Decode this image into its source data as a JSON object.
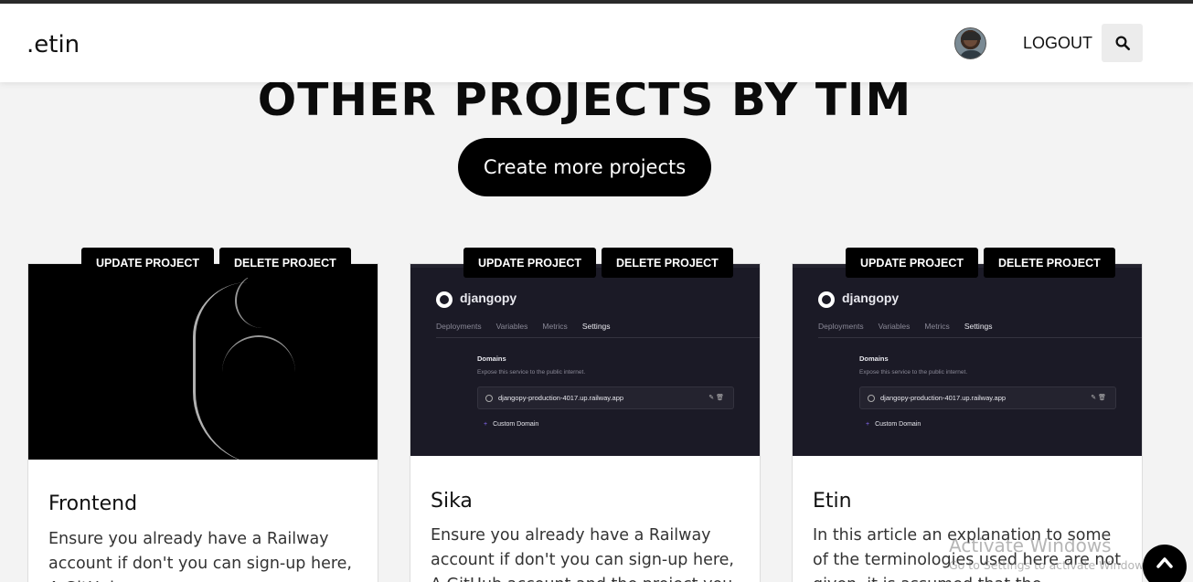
{
  "header": {
    "logo": ".etin",
    "logout_label": "LOGOUT",
    "search_icon": "search-icon",
    "avatar": "user-avatar"
  },
  "main": {
    "title": "OTHER PROJECTS BY TIM",
    "create_button": "Create more projects"
  },
  "projects": [
    {
      "update_label": "UPDATE PROJECT",
      "delete_label": "DELETE PROJECT",
      "image": "silhouette-photo",
      "title": "Frontend",
      "description": "Ensure you already have a Railway account if don't you can sign-up here, A GitHub"
    },
    {
      "update_label": "UPDATE PROJECT",
      "delete_label": "DELETE PROJECT",
      "image": "railway-dashboard-screenshot",
      "screenshot": {
        "app_name": "djangopy",
        "tabs": [
          "Deployments",
          "Variables",
          "Metrics",
          "Settings"
        ],
        "domains_heading": "Domains",
        "domains_sub": "Expose this service to the public internet.",
        "url": "djangopy-production-4017.up.railway.app",
        "custom_domain": "Custom Domain"
      },
      "title": "Sika",
      "description": "Ensure you already have a Railway account if don't you can sign-up here, A GitHub account and the project you"
    },
    {
      "update_label": "UPDATE PROJECT",
      "delete_label": "DELETE PROJECT",
      "image": "railway-dashboard-screenshot",
      "screenshot": {
        "app_name": "djangopy",
        "tabs": [
          "Deployments",
          "Variables",
          "Metrics",
          "Settings"
        ],
        "domains_heading": "Domains",
        "domains_sub": "Expose this service to the public internet.",
        "url": "djangopy-production-4017.up.railway.app",
        "custom_domain": "Custom Domain"
      },
      "title": "Etin",
      "description": "In this article an explanation to some of the terminologies used here are not given, it is assumed that the"
    }
  ],
  "overlay": {
    "watermark_title": "Activate Windows",
    "watermark_sub": "Go to Settings to activate Windows.",
    "scroll_top_icon": "chevron-up-icon"
  },
  "colors": {
    "accent": "#000000",
    "page_bg": "#f3f3f3",
    "header_bg": "#ffffff",
    "dashboard_bg": "#1b1a26"
  }
}
